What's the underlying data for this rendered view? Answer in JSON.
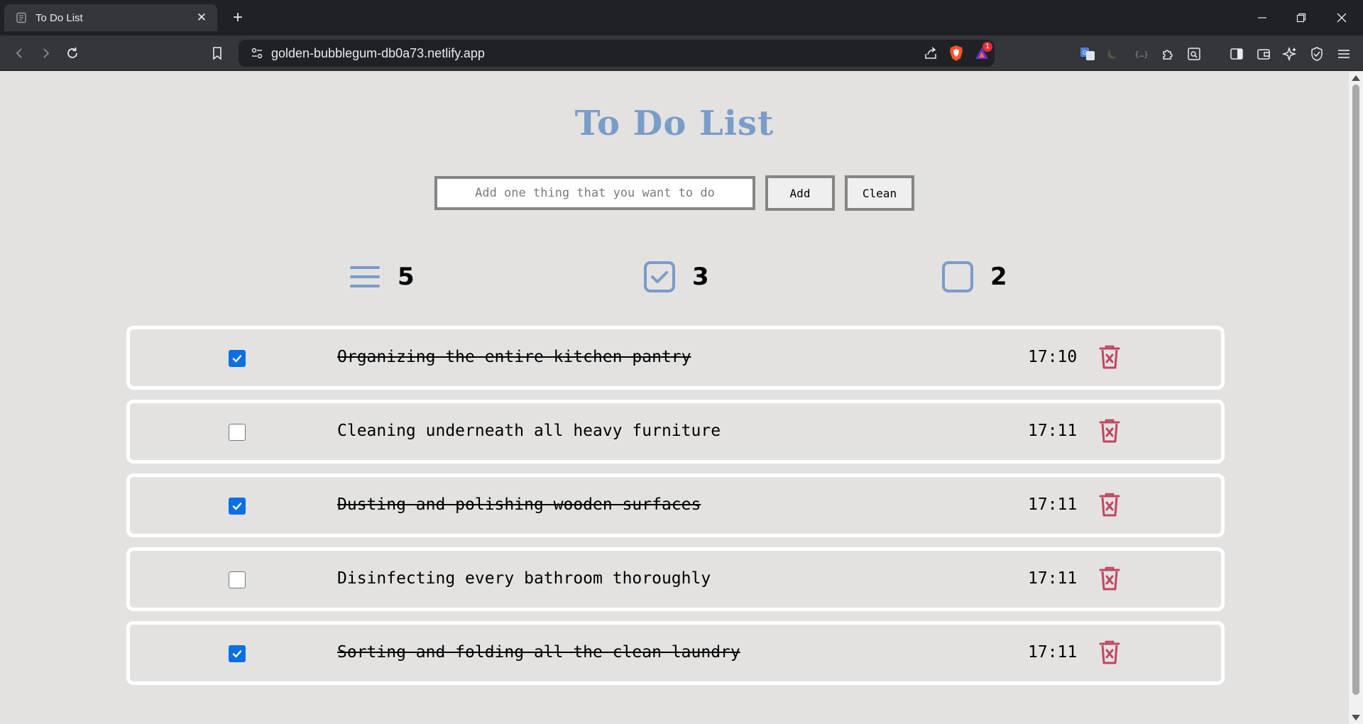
{
  "browser": {
    "tab_title": "To Do List",
    "url": "golden-bubblegum-db0a73.netlify.app",
    "notification_count": "1"
  },
  "app": {
    "title": "To Do List",
    "input_placeholder": "Add one thing that you want to do",
    "add_label": "Add",
    "clean_label": "Clean",
    "accent_color": "#7a9cc9",
    "delete_color": "#c0455f"
  },
  "stats": {
    "total": "5",
    "done": "3",
    "pending": "2"
  },
  "tasks": [
    {
      "text": "Organizing the entire kitchen pantry",
      "time": "17:10",
      "done": true
    },
    {
      "text": "Cleaning underneath all heavy furniture",
      "time": "17:11",
      "done": false
    },
    {
      "text": "Dusting and polishing wooden surfaces",
      "time": "17:11",
      "done": true
    },
    {
      "text": "Disinfecting every bathroom thoroughly",
      "time": "17:11",
      "done": false
    },
    {
      "text": "Sorting and folding all the clean laundry",
      "time": "17:11",
      "done": true
    }
  ]
}
